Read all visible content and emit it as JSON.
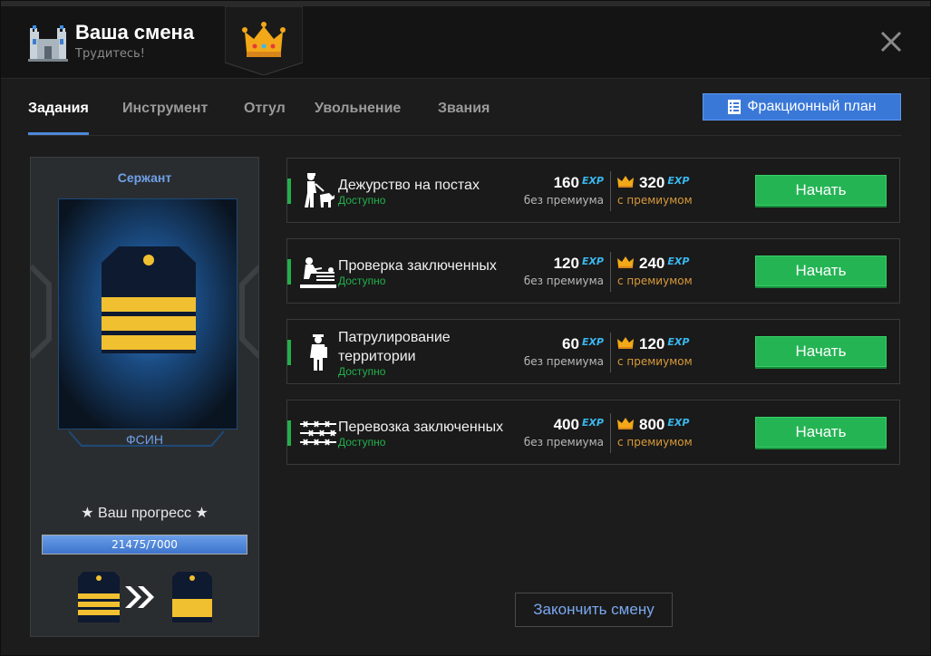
{
  "header": {
    "title": "Ваша смена",
    "subtitle": "Трудитесь!",
    "icon": "castle-icon",
    "crown_icon": "crown-icon",
    "close_icon": "close-icon"
  },
  "tabs": [
    {
      "label": "Задания",
      "active": true
    },
    {
      "label": "Инструмент",
      "active": false
    },
    {
      "label": "Отгул",
      "active": false
    },
    {
      "label": "Увольнение",
      "active": false
    },
    {
      "label": "Звания",
      "active": false
    }
  ],
  "plan_button": {
    "label": "Фракционный план",
    "icon": "checklist-icon"
  },
  "sidebar": {
    "rank": "Сержант",
    "faction": "ФСИН",
    "progress_title": "★ Ваш прогресс ★",
    "progress_text": "21475/7000",
    "progress_fraction": 1.0
  },
  "tasks": [
    {
      "name": "Дежурство на постах",
      "status": "Доступно",
      "base": "160",
      "premium": "320",
      "exp": "EXP",
      "base_label": "без премиума",
      "premium_label": "с премиумом",
      "button": "Начать",
      "icon": "guard-dog-icon"
    },
    {
      "name": "Проверка заключенных",
      "status": "Доступно",
      "base": "120",
      "premium": "240",
      "exp": "EXP",
      "base_label": "без премиума",
      "premium_label": "с премиумом",
      "button": "Начать",
      "icon": "search-prisoner-icon"
    },
    {
      "name": "Патрулирование территории",
      "status": "Доступно",
      "base": "60",
      "premium": "120",
      "exp": "EXP",
      "base_label": "без премиума",
      "premium_label": "с премиумом",
      "button": "Начать",
      "icon": "patrol-officer-icon"
    },
    {
      "name": "Перевозка заключенных",
      "status": "Доступно",
      "base": "400",
      "premium": "800",
      "exp": "EXP",
      "base_label": "без премиума",
      "premium_label": "с премиумом",
      "button": "Начать",
      "icon": "barbed-wire-icon"
    }
  ],
  "finish_button": "Закончить смену",
  "colors": {
    "accent": "#3a78d8",
    "green": "#25b454",
    "premium": "#d89a3a",
    "exp": "#3ab8f0"
  }
}
